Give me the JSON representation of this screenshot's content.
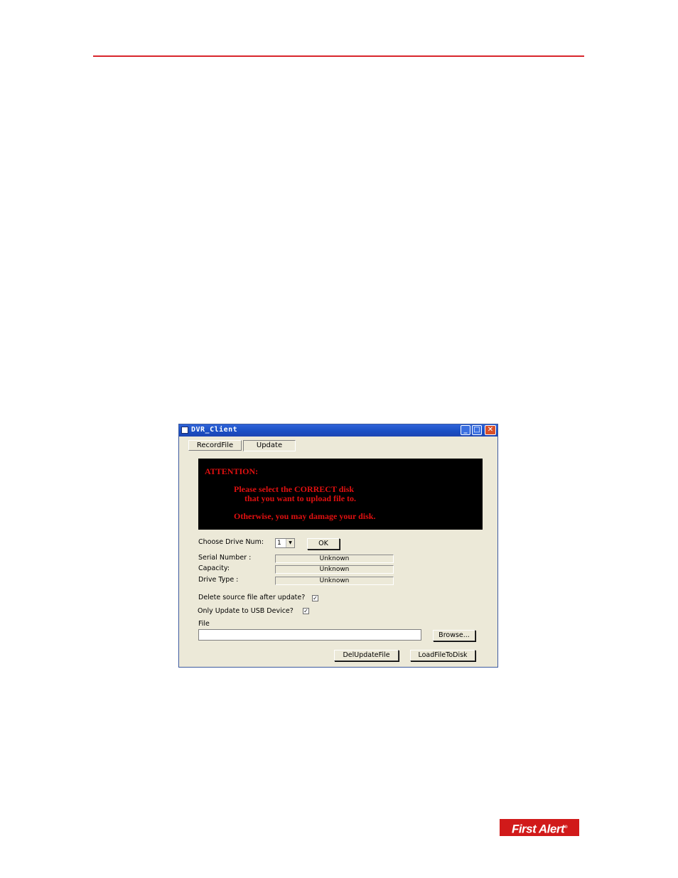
{
  "window": {
    "title": "DVR_Client",
    "controls": {
      "minimize": "_",
      "maximize": "□",
      "close": "✕"
    }
  },
  "tabs": [
    {
      "label": "RecordFile",
      "active": false
    },
    {
      "label": "Update",
      "active": true
    }
  ],
  "attention": {
    "heading": "ATTENTION:",
    "line1": "Please select the CORRECT disk",
    "line2": "that you want to upload file to.",
    "line3": "Otherwise, you may damage your disk.",
    "color": "#e01010"
  },
  "drive": {
    "label": "Choose Drive Num:",
    "selected": "1",
    "ok_label": "OK"
  },
  "info": [
    {
      "label": "Serial Number :",
      "value": "Unknown"
    },
    {
      "label": "Capacity:",
      "value": "Unknown"
    },
    {
      "label": "Drive Type :",
      "value": "Unknown"
    }
  ],
  "options": {
    "delete_source": {
      "label": "Delete source file after update?",
      "checked": true
    },
    "usb_only": {
      "label": "Only Update to USB Device?",
      "checked": true
    }
  },
  "file": {
    "label": "File",
    "value": "",
    "browse_label": "Browse..."
  },
  "actions": {
    "del_label": "DelUpdateFile",
    "load_label": "LoadFileToDisk"
  },
  "branding": {
    "logo_text": "First Alert",
    "logo_color": "#d11a1a",
    "rule_color": "#d9262c"
  }
}
